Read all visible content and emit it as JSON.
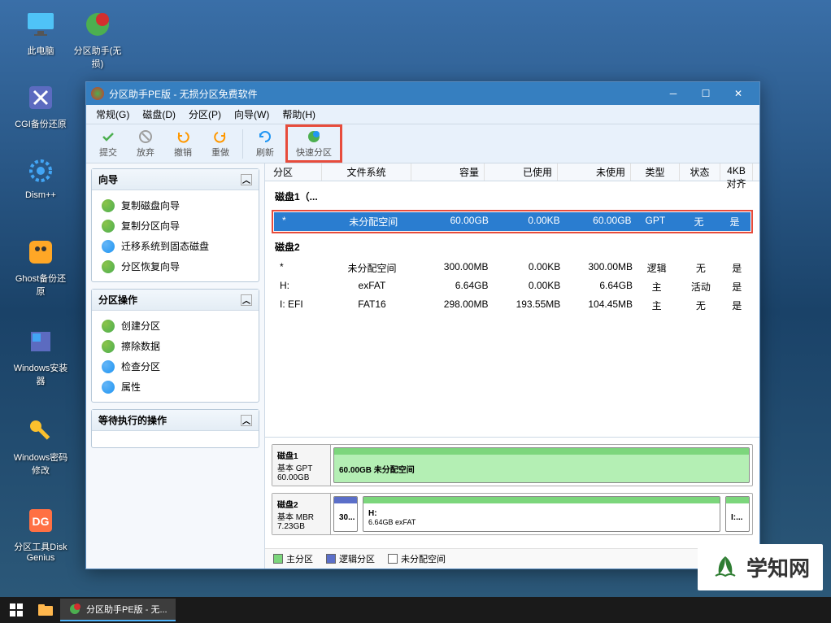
{
  "desktop": {
    "icons": [
      {
        "label": "此电脑",
        "color": "#4fc3f7"
      },
      {
        "label": "分区助手(无损)",
        "color": "#4caf50"
      },
      {
        "label": "CGI备份还原",
        "color": "#5c6bc0"
      },
      {
        "label": "Dism++",
        "color": "#42a5f5"
      },
      {
        "label": "Ghost备份还原",
        "color": "#ffa726"
      },
      {
        "label": "Windows安装器",
        "color": "#5c6bc0"
      },
      {
        "label": "Windows密码修改",
        "color": "#fbc02d"
      },
      {
        "label": "分区工具DiskGenius",
        "color": "#ff7043"
      }
    ]
  },
  "window": {
    "title": "分区助手PE版 - 无损分区免费软件"
  },
  "menu": [
    {
      "label": "常规(G)"
    },
    {
      "label": "磁盘(D)"
    },
    {
      "label": "分区(P)"
    },
    {
      "label": "向导(W)"
    },
    {
      "label": "帮助(H)"
    }
  ],
  "toolbar": [
    {
      "label": "提交",
      "color": "#4caf50"
    },
    {
      "label": "放弃",
      "color": "#9e9e9e"
    },
    {
      "label": "撤销",
      "color": "#ff9800"
    },
    {
      "label": "重做",
      "color": "#ff9800"
    },
    {
      "sep": true
    },
    {
      "label": "刷新",
      "color": "#2196f3"
    },
    {
      "label": "快速分区",
      "color": "#4caf50",
      "highlight": true
    }
  ],
  "sidebar": {
    "wizard_title": "向导",
    "wizard_items": [
      {
        "label": "复制磁盘向导",
        "ico": "green"
      },
      {
        "label": "复制分区向导",
        "ico": "green"
      },
      {
        "label": "迁移系统到固态磁盘",
        "ico": "blue"
      },
      {
        "label": "分区恢复向导",
        "ico": "green"
      }
    ],
    "ops_title": "分区操作",
    "ops_items": [
      {
        "label": "创建分区",
        "ico": "green"
      },
      {
        "label": "擦除数据",
        "ico": "green"
      },
      {
        "label": "检查分区",
        "ico": "blue"
      },
      {
        "label": "属性",
        "ico": "blue"
      }
    ],
    "pending_title": "等待执行的操作"
  },
  "table": {
    "headers": {
      "part": "分区",
      "fs": "文件系统",
      "cap": "容量",
      "used": "已使用",
      "free": "未使用",
      "type": "类型",
      "stat": "状态",
      "k4": "4KB对齐"
    },
    "disk1_title": "磁盘1（...",
    "disk1_rows": [
      {
        "part": "*",
        "fs": "未分配空间",
        "cap": "60.00GB",
        "used": "0.00KB",
        "free": "60.00GB",
        "type": "GPT",
        "stat": "无",
        "k4": "是",
        "selected": true
      }
    ],
    "disk2_title": "磁盘2",
    "disk2_rows": [
      {
        "part": "*",
        "fs": "未分配空间",
        "cap": "300.00MB",
        "used": "0.00KB",
        "free": "300.00MB",
        "type": "逻辑",
        "stat": "无",
        "k4": "是"
      },
      {
        "part": "H:",
        "fs": "exFAT",
        "cap": "6.64GB",
        "used": "0.00KB",
        "free": "6.64GB",
        "type": "主",
        "stat": "活动",
        "k4": "是"
      },
      {
        "part": "I: EFI",
        "fs": "FAT16",
        "cap": "298.00MB",
        "used": "193.55MB",
        "free": "104.45MB",
        "type": "主",
        "stat": "无",
        "k4": "是"
      }
    ]
  },
  "visual": {
    "disk1": {
      "name": "磁盘1",
      "type": "基本 GPT",
      "size": "60.00GB",
      "seg_label": "60.00GB 未分配空间"
    },
    "disk2": {
      "name": "磁盘2",
      "type": "基本 MBR",
      "size": "7.23GB",
      "seg1_label": "30...",
      "seg2_title": "H:",
      "seg2_sub": "6.64GB exFAT",
      "seg3_title": "I:...",
      "seg3_sub": ""
    }
  },
  "legend": {
    "primary": "主分区",
    "logical": "逻辑分区",
    "unalloc": "未分配空间"
  },
  "taskbar": {
    "app": "分区助手PE版 - 无..."
  },
  "watermark": "学知网"
}
